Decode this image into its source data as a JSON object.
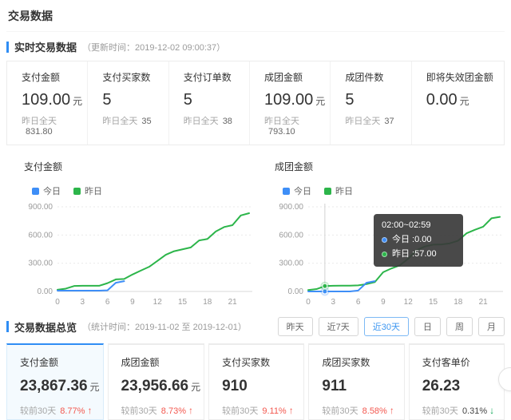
{
  "page": {
    "title": "交易数据"
  },
  "realtime": {
    "section_title": "实时交易数据",
    "update_note": "（更新时间：2019-12-02 09:00:37）",
    "cards": [
      {
        "label": "支付金额",
        "value": "109.00",
        "unit": "元",
        "sub_label": "昨日全天",
        "sub_value": "831.80"
      },
      {
        "label": "支付买家数",
        "value": "5",
        "unit": "",
        "sub_label": "昨日全天",
        "sub_value": "35"
      },
      {
        "label": "支付订单数",
        "value": "5",
        "unit": "",
        "sub_label": "昨日全天",
        "sub_value": "38"
      },
      {
        "label": "成团金额",
        "value": "109.00",
        "unit": "元",
        "sub_label": "昨日全天",
        "sub_value": "793.10"
      },
      {
        "label": "成团件数",
        "value": "5",
        "unit": "",
        "sub_label": "昨日全天",
        "sub_value": "37"
      },
      {
        "label": "即将失效团金额",
        "value": "0.00",
        "unit": "元",
        "sub_label": "",
        "sub_value": ""
      }
    ]
  },
  "chart_data": [
    {
      "type": "line",
      "title": "支付金额",
      "legend": [
        "今日",
        "昨日"
      ],
      "xlabel": "",
      "ylabel": "",
      "xmax": 23,
      "xticks": [
        0,
        3,
        6,
        9,
        12,
        15,
        18,
        21
      ],
      "ylim": [
        0,
        900
      ],
      "yticks": [
        [
          0,
          "0.00"
        ],
        [
          300,
          "300.00"
        ],
        [
          600,
          "600.00"
        ],
        [
          900,
          "900.00"
        ]
      ],
      "grid": "dotted-horizontal",
      "legend_position": "top-left",
      "series": [
        {
          "name": "今日",
          "color": "#3e8ef7",
          "values": [
            8,
            8,
            8,
            8,
            8,
            8,
            12,
            92,
            109
          ]
        },
        {
          "name": "昨日",
          "color": "#2cb54a",
          "values": [
            18,
            30,
            58,
            60,
            60,
            60,
            88,
            128,
            133,
            180,
            222,
            262,
            325,
            390,
            428,
            448,
            468,
            542,
            558,
            638,
            685,
            705,
            808,
            832
          ]
        }
      ]
    },
    {
      "type": "line",
      "title": "成团金额",
      "legend": [
        "今日",
        "昨日"
      ],
      "xlabel": "",
      "ylabel": "",
      "xmax": 23,
      "xticks": [
        0,
        3,
        6,
        9,
        12,
        15,
        18,
        21
      ],
      "ylim": [
        0,
        900
      ],
      "yticks": [
        [
          0,
          "0.00"
        ],
        [
          300,
          "300.00"
        ],
        [
          600,
          "600.00"
        ],
        [
          900,
          "900.00"
        ]
      ],
      "grid": "dotted-horizontal",
      "legend_position": "top-left",
      "series": [
        {
          "name": "今日",
          "color": "#3e8ef7",
          "values": [
            0,
            0,
            0,
            0,
            0,
            0,
            10,
            92,
            109
          ]
        },
        {
          "name": "昨日",
          "color": "#2cb54a",
          "values": [
            15,
            25,
            57,
            60,
            62,
            62,
            65,
            78,
            100,
            205,
            245,
            278,
            348,
            438,
            478,
            498,
            500,
            512,
            540,
            618,
            655,
            688,
            778,
            793
          ]
        }
      ],
      "marker": {
        "hour": 2,
        "points": [
          {
            "series": 0,
            "value": 0
          },
          {
            "series": 1,
            "value": 57
          }
        ]
      },
      "tooltip": {
        "title": "02:00~02:59",
        "rows": [
          {
            "label": "今日 : ",
            "value": "0.00"
          },
          {
            "label": "昨日 : ",
            "value": "57.00"
          }
        ]
      }
    }
  ],
  "overview": {
    "section_title": "交易数据总览",
    "range_note": "（统计时间：2019-11-02 至 2019-12-01）",
    "tabs": [
      {
        "label": "昨天",
        "active": false
      },
      {
        "label": "近7天",
        "active": false
      },
      {
        "label": "近30天",
        "active": true
      },
      {
        "label": "日",
        "active": false
      },
      {
        "label": "周",
        "active": false
      },
      {
        "label": "月",
        "active": false
      }
    ],
    "cards": [
      {
        "label": "支付金额",
        "value": "23,867.36",
        "unit": "元",
        "compare_label": "较前30天",
        "pct": "8.77%",
        "arrow": "↑",
        "direction": "up",
        "selected": true
      },
      {
        "label": "成团金额",
        "value": "23,956.66",
        "unit": "元",
        "compare_label": "较前30天",
        "pct": "8.73%",
        "arrow": "↑",
        "direction": "up",
        "selected": false
      },
      {
        "label": "支付买家数",
        "value": "910",
        "unit": "",
        "compare_label": "较前30天",
        "pct": "9.11%",
        "arrow": "↑",
        "direction": "up",
        "selected": false
      },
      {
        "label": "成团买家数",
        "value": "911",
        "unit": "",
        "compare_label": "较前30天",
        "pct": "8.58%",
        "arrow": "↑",
        "direction": "up",
        "selected": false
      },
      {
        "label": "支付客单价",
        "value": "26.23",
        "unit": "",
        "compare_label": "较前30天",
        "pct": "0.31%",
        "arrow": "↓",
        "direction": "down",
        "selected": false
      }
    ]
  },
  "colors": {
    "accent_blue": "#2f8df4",
    "line_today": "#3e8ef7",
    "line_yesterday": "#2cb54a",
    "trend_up_red": "#f3584f",
    "trend_down_green": "#0fa958"
  }
}
